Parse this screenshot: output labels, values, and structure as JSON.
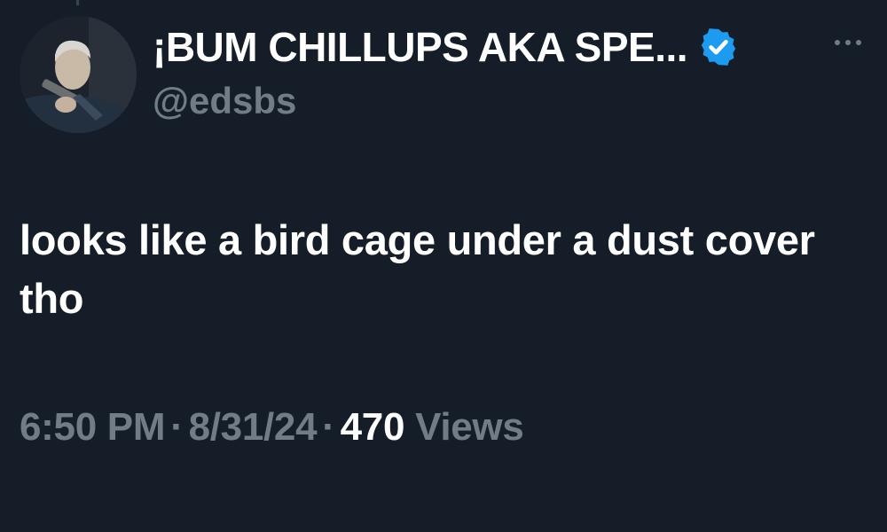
{
  "tweet": {
    "display_name": "¡BUM CHILLUPS AKA SPE...",
    "handle": "@edsbs",
    "text": "looks like a bird cage under a dust cover tho",
    "time": "6:50 PM",
    "separator": "·",
    "date": "8/31/24",
    "views_count": "470",
    "views_label": "Views",
    "verified": true
  },
  "icons": {
    "verified": "verified-badge-icon",
    "more": "more-options-icon"
  },
  "colors": {
    "background": "#151d28",
    "primary_text": "#ffffff",
    "secondary_text": "#717c87",
    "verified_blue": "#1d9bf0"
  }
}
